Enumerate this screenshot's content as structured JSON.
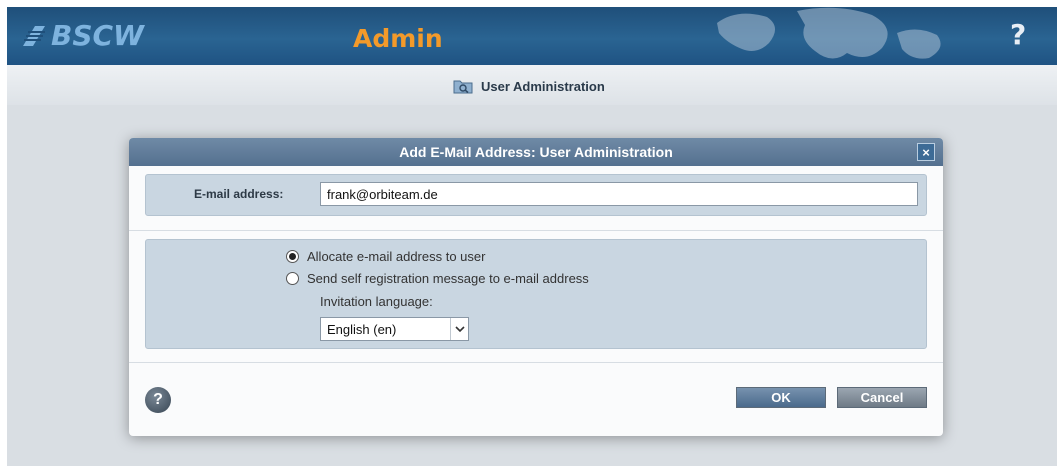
{
  "header": {
    "logo_text": "BSCW",
    "app_title": "Admin",
    "help_label": "?"
  },
  "breadcrumb": {
    "icon": "folder-search-icon",
    "label": "User Administration"
  },
  "dialog": {
    "title": "Add E-Mail Address: User Administration",
    "close_label": "×",
    "email": {
      "label": "E-mail address:",
      "value": "frank@orbiteam.de"
    },
    "options": [
      {
        "label": "Allocate e-mail address to user",
        "selected": true
      },
      {
        "label": "Send self registration message to e-mail address",
        "selected": false
      }
    ],
    "invitation_language": {
      "label": "Invitation language:",
      "selected": "English (en)"
    },
    "help_label": "?",
    "ok_label": "OK",
    "cancel_label": "Cancel"
  },
  "colors": {
    "header_bg": "#1f4f7a",
    "accent_orange": "#f39a2a",
    "dialog_titlebar": "#5f7b99",
    "panel_bg": "#c9d6e1"
  }
}
